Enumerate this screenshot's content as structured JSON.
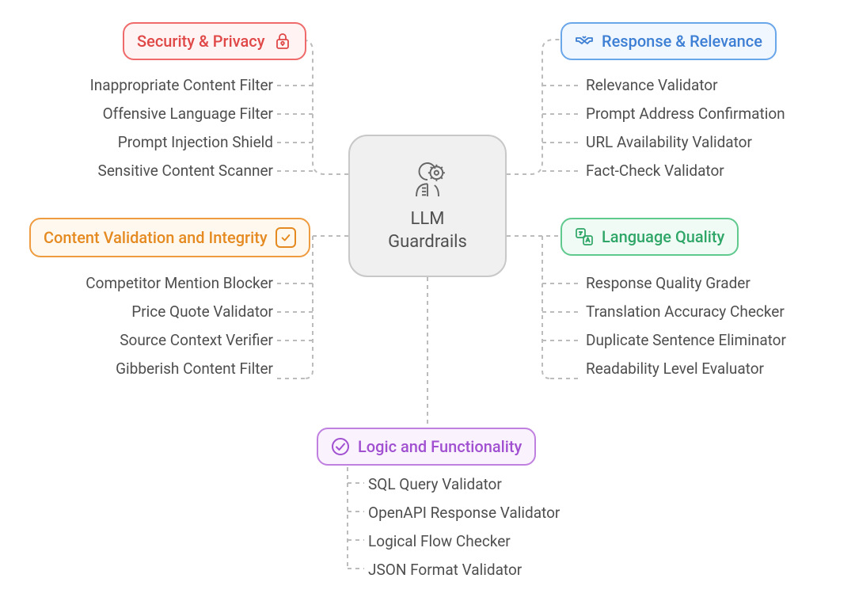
{
  "center": {
    "line1": "LLM",
    "line2": "Guardrails"
  },
  "security": {
    "title": "Security & Privacy",
    "items": [
      "Inappropriate Content Filter",
      "Offensive Language Filter",
      "Prompt Injection Shield",
      "Sensitive Content Scanner"
    ]
  },
  "content": {
    "title": "Content Validation and Integrity",
    "items": [
      "Competitor Mention Blocker",
      "Price Quote Validator",
      "Source Context Verifier",
      "Gibberish Content Filter"
    ]
  },
  "response": {
    "title": "Response & Relevance",
    "items": [
      "Relevance Validator",
      "Prompt Address Confirmation",
      "URL Availability Validator",
      "Fact-Check Validator"
    ]
  },
  "language": {
    "title": "Language Quality",
    "items": [
      "Response Quality Grader",
      "Translation Accuracy Checker",
      "Duplicate Sentence Eliminator",
      "Readability Level Evaluator"
    ]
  },
  "logic": {
    "title": "Logic and Functionality",
    "items": [
      "SQL Query Validator",
      "OpenAPI Response Validator",
      "Logical Flow Checker",
      "JSON Format Validator"
    ]
  }
}
